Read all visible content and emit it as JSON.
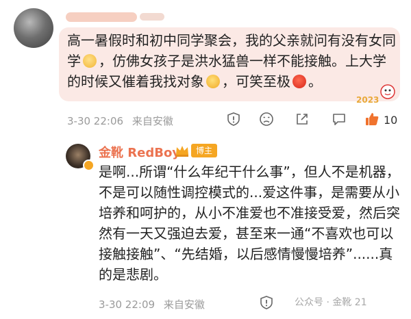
{
  "comment": {
    "text_1": "高一暑假时和初中同学聚会，我的父亲就问有没有女同学",
    "text_2": "，仿佛女孩子是洪水猛兽一样不能接触。上大学的时候又催着我找对象",
    "text_3": "，可笑至极",
    "text_4": "。",
    "emojis": [
      "shy-face",
      "laughing-face",
      "angry-face"
    ],
    "date": "3-30 22:06",
    "source": "来自安徽",
    "like_count": "10"
  },
  "reply": {
    "username": "金靴 RedBoy",
    "badge": "博主",
    "text": "是啊...所谓“什么年纪干什么事”，但人不是机器，不是可以随性调控模式的...爱这件事，是需要从小培养和呵护的，从小不准爱也不准接受爱，然后突然有一天又强迫去爱，甚至来一通“不喜欢也可以接触接触”、“先结婚，以后感情慢慢培养”......真的是悲剧。",
    "date": "3-30 22:09",
    "source": "来自安徽"
  },
  "watermark": "公众号 · 金靴 21",
  "colors": {
    "bubble": "#fbe9e5",
    "username": "#eb7350",
    "badge": "#f5a623",
    "like": "#f0732e",
    "meta": "#9a9a9a"
  }
}
